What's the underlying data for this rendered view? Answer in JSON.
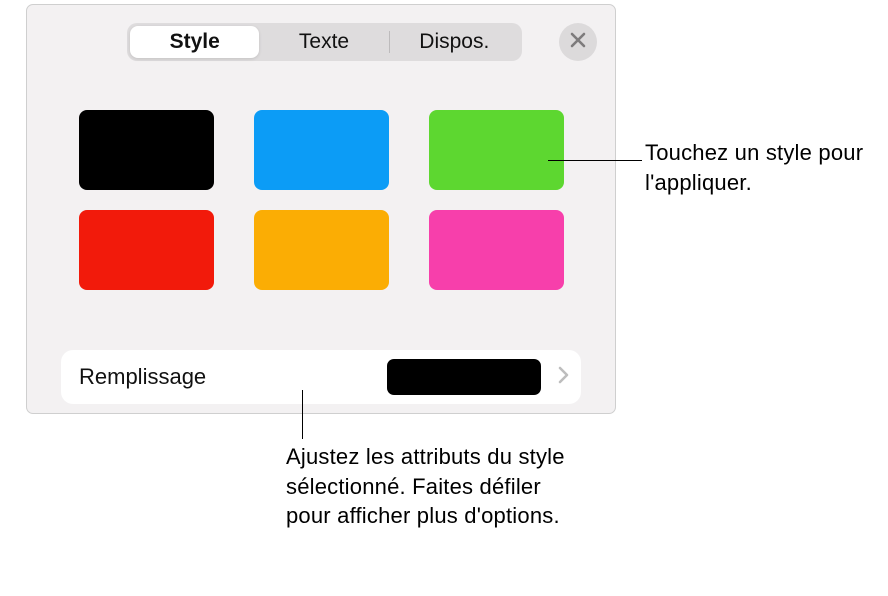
{
  "tabs": {
    "style": "Style",
    "text": "Texte",
    "layout": "Dispos."
  },
  "swatches": [
    {
      "name": "black",
      "color": "#000000"
    },
    {
      "name": "blue",
      "color": "#0c9cf6"
    },
    {
      "name": "green",
      "color": "#5dd730"
    },
    {
      "name": "red",
      "color": "#f21a0b"
    },
    {
      "name": "orange",
      "color": "#fbad04"
    },
    {
      "name": "pink",
      "color": "#f73fab"
    }
  ],
  "fill": {
    "label": "Remplissage",
    "swatch_color": "#000000"
  },
  "callouts": {
    "apply_style": "Touchez un style pour l'appliquer.",
    "adjust_attrs": "Ajustez les attributs du style sélectionné. Faites défiler pour afficher plus d'options."
  }
}
